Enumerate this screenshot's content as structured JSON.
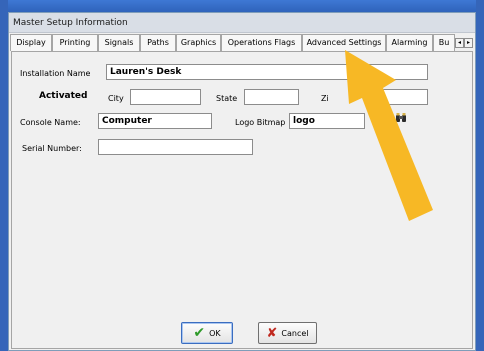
{
  "window": {
    "title": "Master Setup Information"
  },
  "tabs": [
    {
      "label": "Display"
    },
    {
      "label": "Printing"
    },
    {
      "label": "Signals"
    },
    {
      "label": "Paths"
    },
    {
      "label": "Graphics"
    },
    {
      "label": "Operations Flags"
    },
    {
      "label": "Advanced Settings"
    },
    {
      "label": "Alarming"
    },
    {
      "label": "Bu"
    }
  ],
  "tab_scroll": {
    "left_icon": "triangle-left-icon",
    "right_icon": "triangle-right-icon",
    "left_glyph": "◂",
    "right_glyph": "▸"
  },
  "form": {
    "installation_name_label": "Installation Name",
    "installation_name_value": "Lauren's Desk",
    "activated_label": "Activated",
    "city_label": "City",
    "city_value": "",
    "state_label": "State",
    "state_value": "",
    "zip_label": "Zi",
    "zip_value": "",
    "console_name_label": "Console Name:",
    "console_name_value": "Computer",
    "logo_bitmap_label": "Logo Bitmap",
    "logo_bitmap_value": "logo",
    "logo_browse_icon": "binoculars-icon",
    "serial_number_label": "Serial Number:",
    "serial_number_value": ""
  },
  "buttons": {
    "ok_label": "OK",
    "ok_icon": "checkmark-icon",
    "cancel_label": "Cancel",
    "cancel_icon": "x-icon"
  },
  "colors": {
    "arrow": "#f7b825",
    "check": "#2f9a2a",
    "x": "#c0281e"
  },
  "annotation": {
    "icon": "arrow-icon"
  }
}
